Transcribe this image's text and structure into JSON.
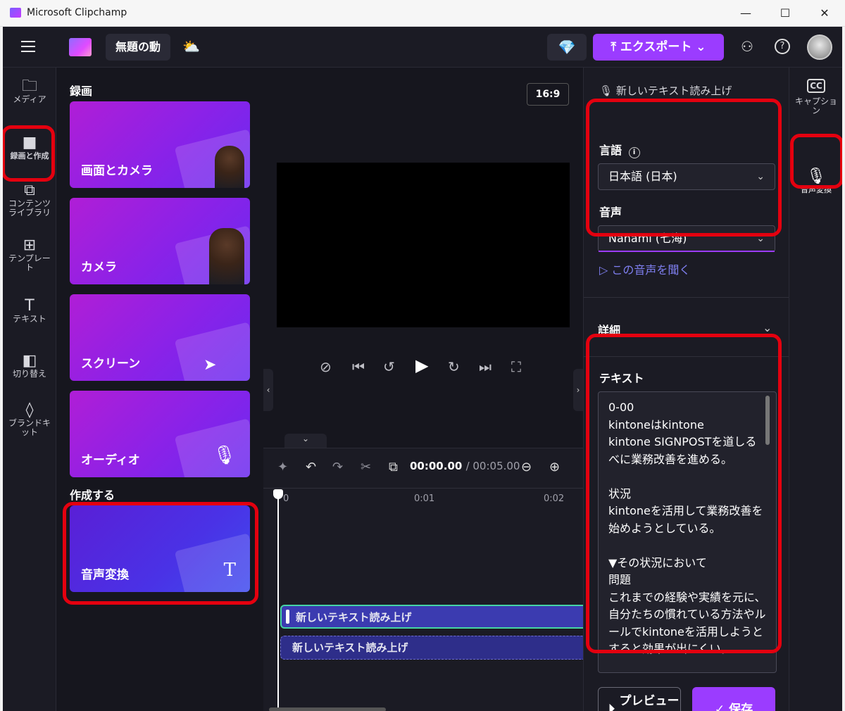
{
  "window": {
    "title": "Microsoft Clipchamp",
    "minimize": "—",
    "maximize": "☐",
    "close": "✕"
  },
  "topbar": {
    "project_title": "無題の動",
    "cloud_icon": "⛅",
    "gem_icon": "💎",
    "export_label": "⤒ エクスポート ⌄",
    "share_icon": "⚇",
    "help_icon": "?"
  },
  "leftrail": {
    "items": [
      {
        "icon": "🗀",
        "label": "メディア"
      },
      {
        "icon": "■",
        "label": "録画と作成"
      },
      {
        "icon": "⧉",
        "label": "コンテンツライブラリ"
      },
      {
        "icon": "⊞",
        "label": "テンプレート"
      },
      {
        "icon": "T",
        "label": "テキスト"
      },
      {
        "icon": "◧",
        "label": "切り替え"
      },
      {
        "icon": "◊",
        "label": "ブランドキット"
      }
    ]
  },
  "record_panel": {
    "section_record": "録画",
    "cards": [
      "画面とカメラ",
      "カメラ",
      "スクリーン",
      "オーディオ"
    ],
    "section_create": "作成する",
    "tts_card": "音声変換"
  },
  "preview": {
    "ratio": "16:9",
    "controls": [
      "⊘",
      "⏮",
      "↺",
      "▶",
      "↻",
      "⏭",
      "⛶"
    ]
  },
  "timeline": {
    "tools": [
      "✦",
      "↶",
      "↷",
      "✂",
      "⧉"
    ],
    "current_time": "00:00.00",
    "duration": "/ 00:05.00",
    "zoom_out": "⊖",
    "zoom_in": "⊕",
    "ruler": [
      "0",
      "0:01",
      "0:02"
    ],
    "clips": [
      "新しいテキスト読み上げ",
      "新しいテキスト読み上げ"
    ]
  },
  "right_panel": {
    "header": "新しいテキスト読み上げ",
    "language_label": "言語",
    "language_value": "日本語 (日本)",
    "voice_label": "音声",
    "voice_value": "Nanami (七海)",
    "listen_link": "この音声を聞く",
    "details_label": "詳細",
    "text_label": "テキスト",
    "text_content": "0-00\nkintoneはkintone\nkintone SIGNPOSTを道しるべに業務改善を進める。\n\n状況\nkintoneを活用して業務改善を始めようとしている。\n\n▼その状況において\n問題\nこれまでの経験や実績を元に、自分たちの慣れている方法やルールでkintoneを活用しようとすると効果が出にくい。",
    "preview_button": "プレビュー",
    "save_button": "保存"
  },
  "right_rail": {
    "captions_icon": "CC",
    "captions_label": "キャプション",
    "tts_label": "音声変換"
  },
  "colors": {
    "accent": "#9b3cff",
    "annotation": "#e4000f",
    "clip_border": "#45d4a4"
  }
}
